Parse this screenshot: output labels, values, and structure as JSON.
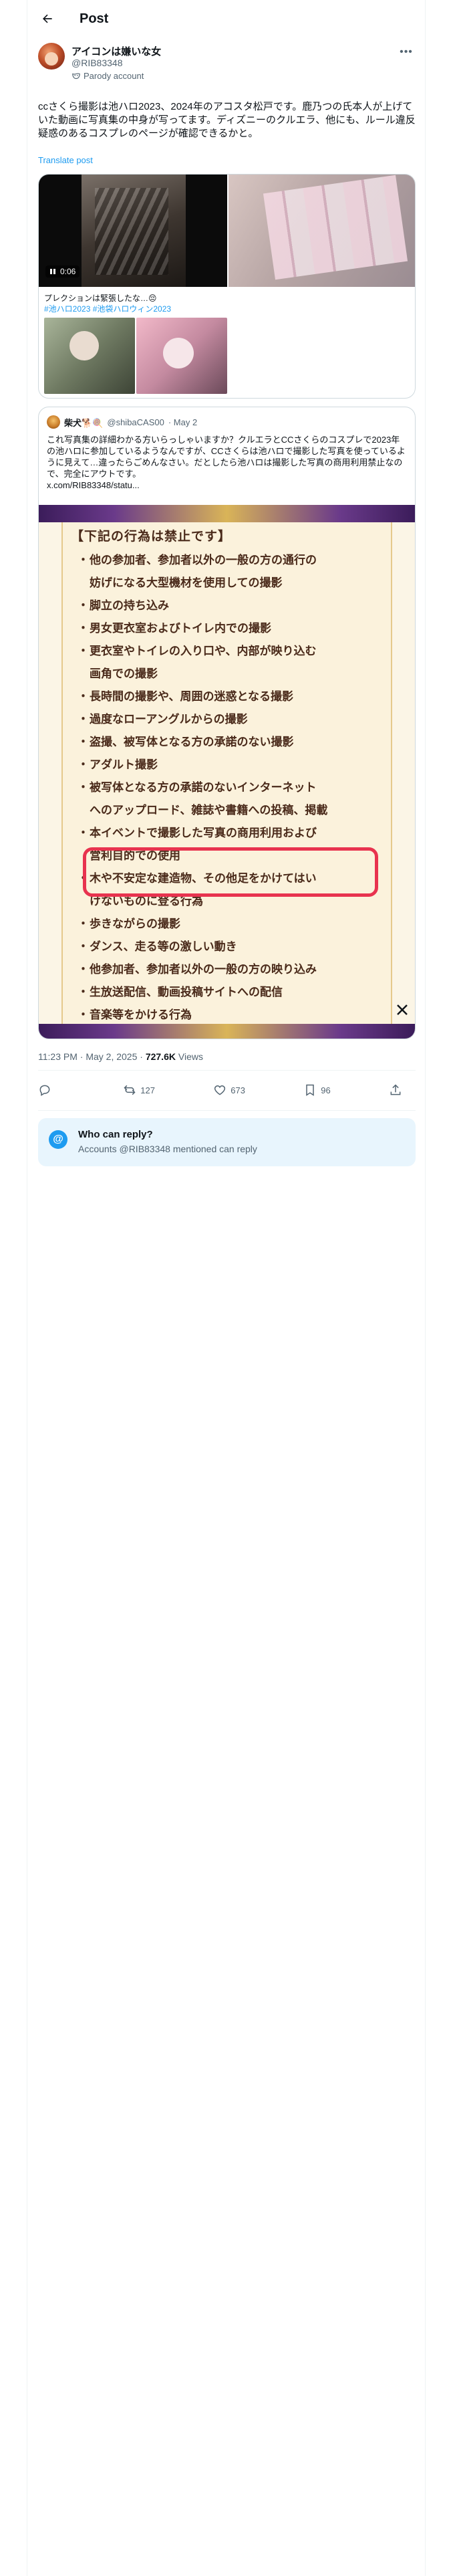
{
  "header": {
    "title": "Post"
  },
  "author": {
    "name": "アイコンは嫌いな女",
    "handle": "@RIB83348",
    "parody_label": "Parody account"
  },
  "tweet": {
    "text": "ccさくら撮影は池ハロ2023、2024年のアコスタ松戸です。鹿乃つの氏本人が上げていた動画に写真集の中身が写ってます。ディズニーのクルエラ、他にも、ルール違反疑惑のあるコスプレのページが確認できるかと。",
    "translate": "Translate post"
  },
  "media": {
    "video_time": "0:06",
    "caption": "プレクションは緊張したな…😔",
    "hashtags": "#池ハロ2023 #池袋ハロウィン2023"
  },
  "quote": {
    "name": "柴犬🐕🍭",
    "handle": "@shibaCAS00",
    "date": "· May 2",
    "text": "これ写真集の詳細わかる方いらっしゃいますか？クルエラとCCさくらのコスプレで2023年の池ハロに参加しているようなんですが、CCさくらは池ハロで撮影した写真を使っているように見えて…違ったらごめんなさい。だとしたら池ハロは撮影した写真の商用利用禁止なので、完全にアウトです。",
    "link": "x.com/RIB83348/statu...",
    "rules_title": "【下記の行為は禁止です】",
    "rules": [
      {
        "line1": "他の参加者、参加者以外の一般の方の通行の",
        "line2": "妨げになる大型機材を使用しての撮影"
      },
      {
        "line1": "脚立の持ち込み",
        "line2": ""
      },
      {
        "line1": "男女更衣室およびトイレ内での撮影",
        "line2": ""
      },
      {
        "line1": "更衣室やトイレの入り口や、内部が映り込む",
        "line2": "画角での撮影"
      },
      {
        "line1": "長時間の撮影や、周囲の迷惑となる撮影",
        "line2": ""
      },
      {
        "line1": "過度なローアングルからの撮影",
        "line2": ""
      },
      {
        "line1": "盗撮、被写体となる方の承諾のない撮影",
        "line2": ""
      },
      {
        "line1": "アダルト撮影",
        "line2": ""
      },
      {
        "line1": "被写体となる方の承諾のないインターネット",
        "line2": "へのアップロード、雑誌や書籍への投稿、掲載"
      },
      {
        "line1": "本イベントで撮影した写真の商用利用および",
        "line2": "営利目的での使用"
      },
      {
        "line1": "木や不安定な建造物、その他足をかけてはい",
        "line2": "けないものに登る行為"
      },
      {
        "line1": "歩きながらの撮影",
        "line2": ""
      },
      {
        "line1": "ダンス、走る等の激しい動き",
        "line2": ""
      },
      {
        "line1": "他参加者、参加者以外の一般の方の映り込み",
        "line2": ""
      },
      {
        "line1": "生放送配信、動画投稿サイトへの配信",
        "line2": ""
      },
      {
        "line1": "音楽等をかける行為",
        "line2": ""
      }
    ]
  },
  "meta": {
    "time": "11:23 PM · May 2, 2025 · ",
    "views_count": "727.6K",
    "views_label": " Views"
  },
  "actions": {
    "reply_count": "",
    "repost_count": "127",
    "like_count": "673",
    "bookmark_count": "96"
  },
  "reply_restriction": {
    "title": "Who can reply?",
    "subtitle": "Accounts @RIB83348 mentioned can reply"
  },
  "colors": {
    "accent": "#1d9bf0",
    "text": "#0f1419",
    "muted": "#536471",
    "highlight": "#e8334f"
  }
}
